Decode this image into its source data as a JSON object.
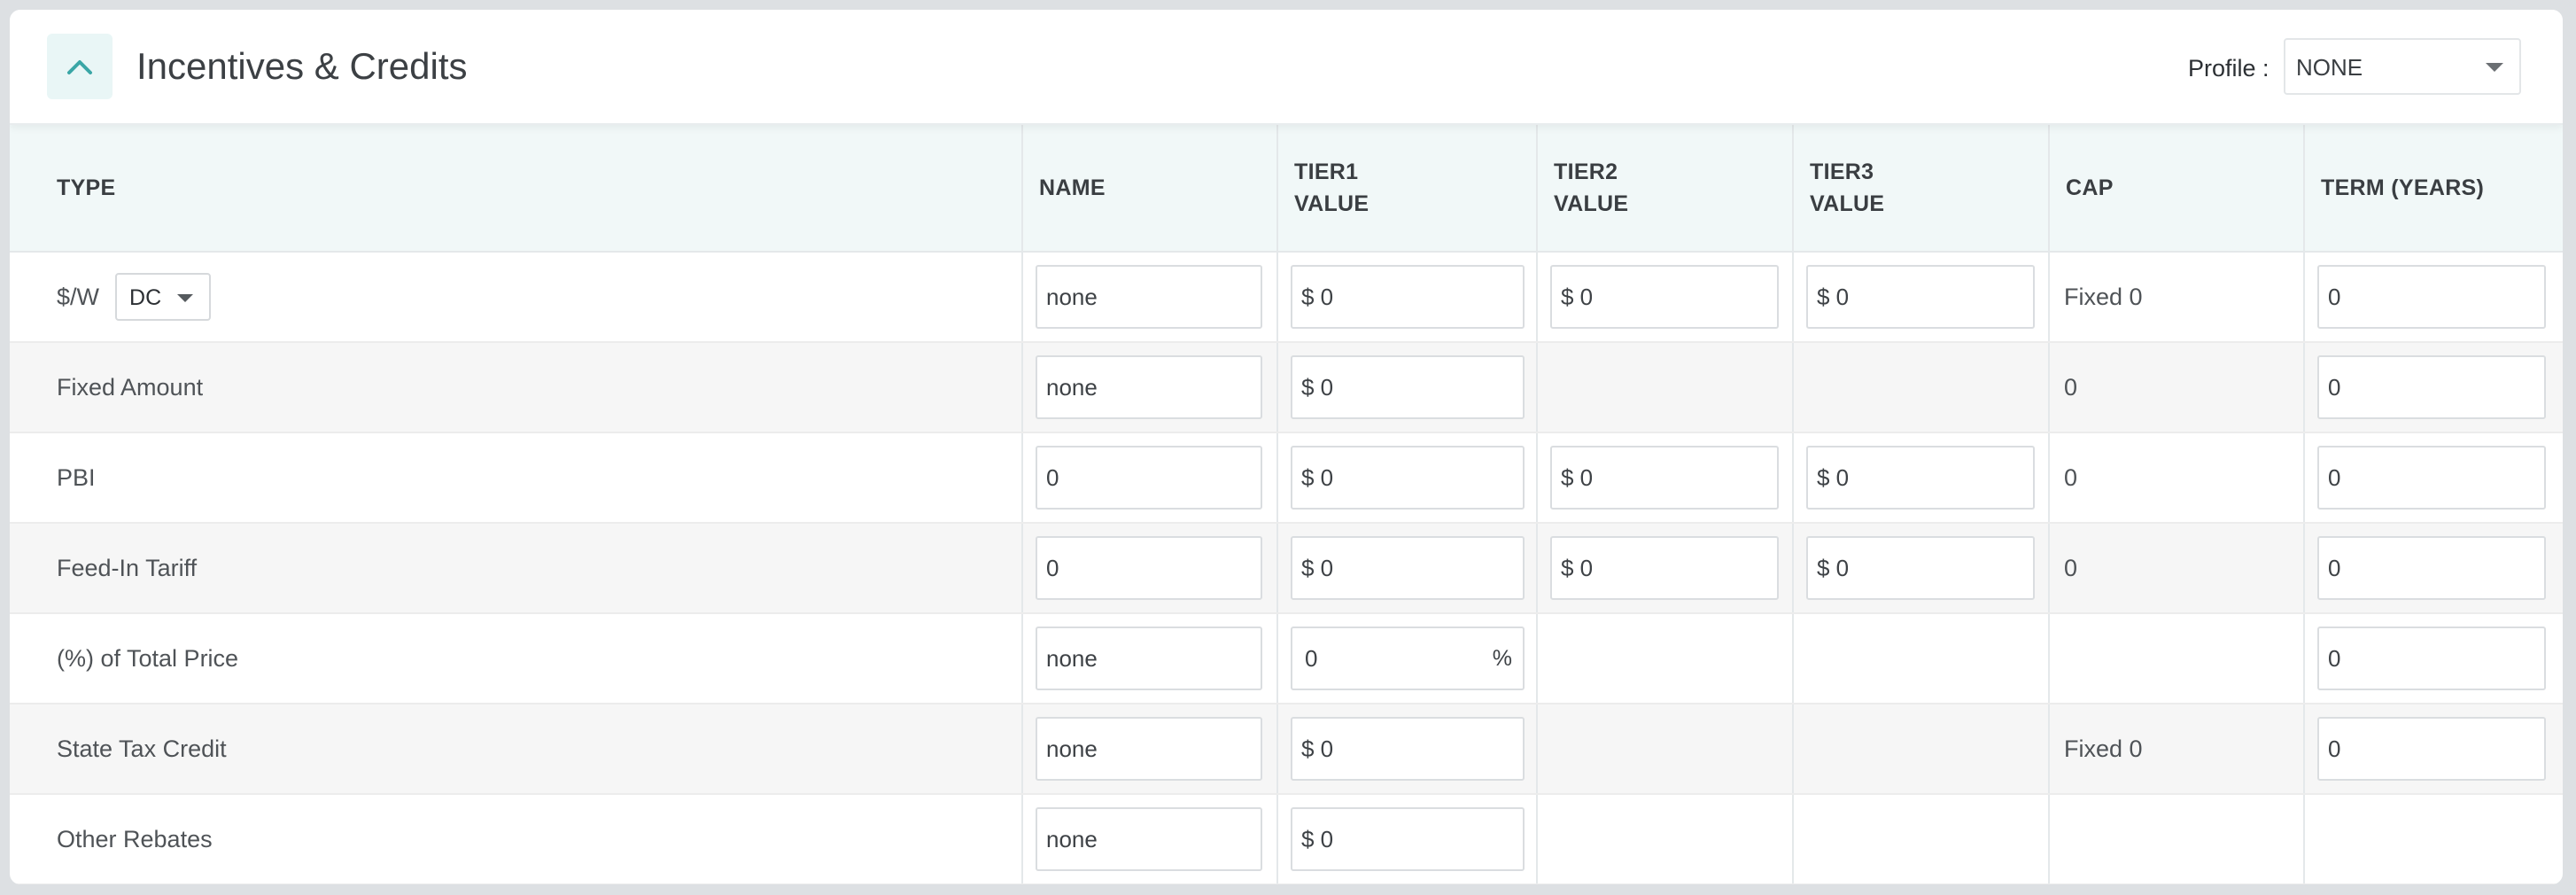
{
  "header": {
    "title": "Incentives & Credits",
    "profile_label": "Profile :",
    "profile_value": "NONE"
  },
  "columns": [
    "TYPE",
    "NAME",
    "TIER1\nVALUE",
    "TIER2\nVALUE",
    "TIER3\nVALUE",
    "CAP",
    "TERM (YEARS)"
  ],
  "rows": [
    {
      "type": "$/W",
      "unit_select": "DC",
      "name": "none",
      "tier1": "$ 0",
      "tier2": "$ 0",
      "tier3": "$ 0",
      "cap": "Fixed 0",
      "term": "0"
    },
    {
      "type": "Fixed Amount",
      "name": "none",
      "tier1": "$ 0",
      "cap": "0",
      "term": "0"
    },
    {
      "type": "PBI",
      "name": "0",
      "tier1": "$ 0",
      "tier2": "$ 0",
      "tier3": "$ 0",
      "cap": "0",
      "term": "0"
    },
    {
      "type": "Feed-In Tariff",
      "name": "0",
      "tier1": "$ 0",
      "tier2": "$ 0",
      "tier3": "$ 0",
      "cap": "0",
      "term": "0"
    },
    {
      "type": "(%) of Total Price",
      "name": "none",
      "tier1": "0",
      "tier1_suffix": "%",
      "term": "0"
    },
    {
      "type": "State Tax Credit",
      "name": "none",
      "tier1": "$ 0",
      "cap": "Fixed 0",
      "term": "0"
    },
    {
      "type": "Other Rebates",
      "name": "none",
      "tier1": "$ 0"
    }
  ],
  "colors": {
    "accent": "#3aa6a6",
    "header_row_bg": "#f1f8f8",
    "stripe_bg": "#f6f6f6",
    "page_bg": "#dde0e3"
  },
  "icons": {
    "collapse": "chevron-up-icon",
    "dropdown": "caret-down-icon"
  }
}
